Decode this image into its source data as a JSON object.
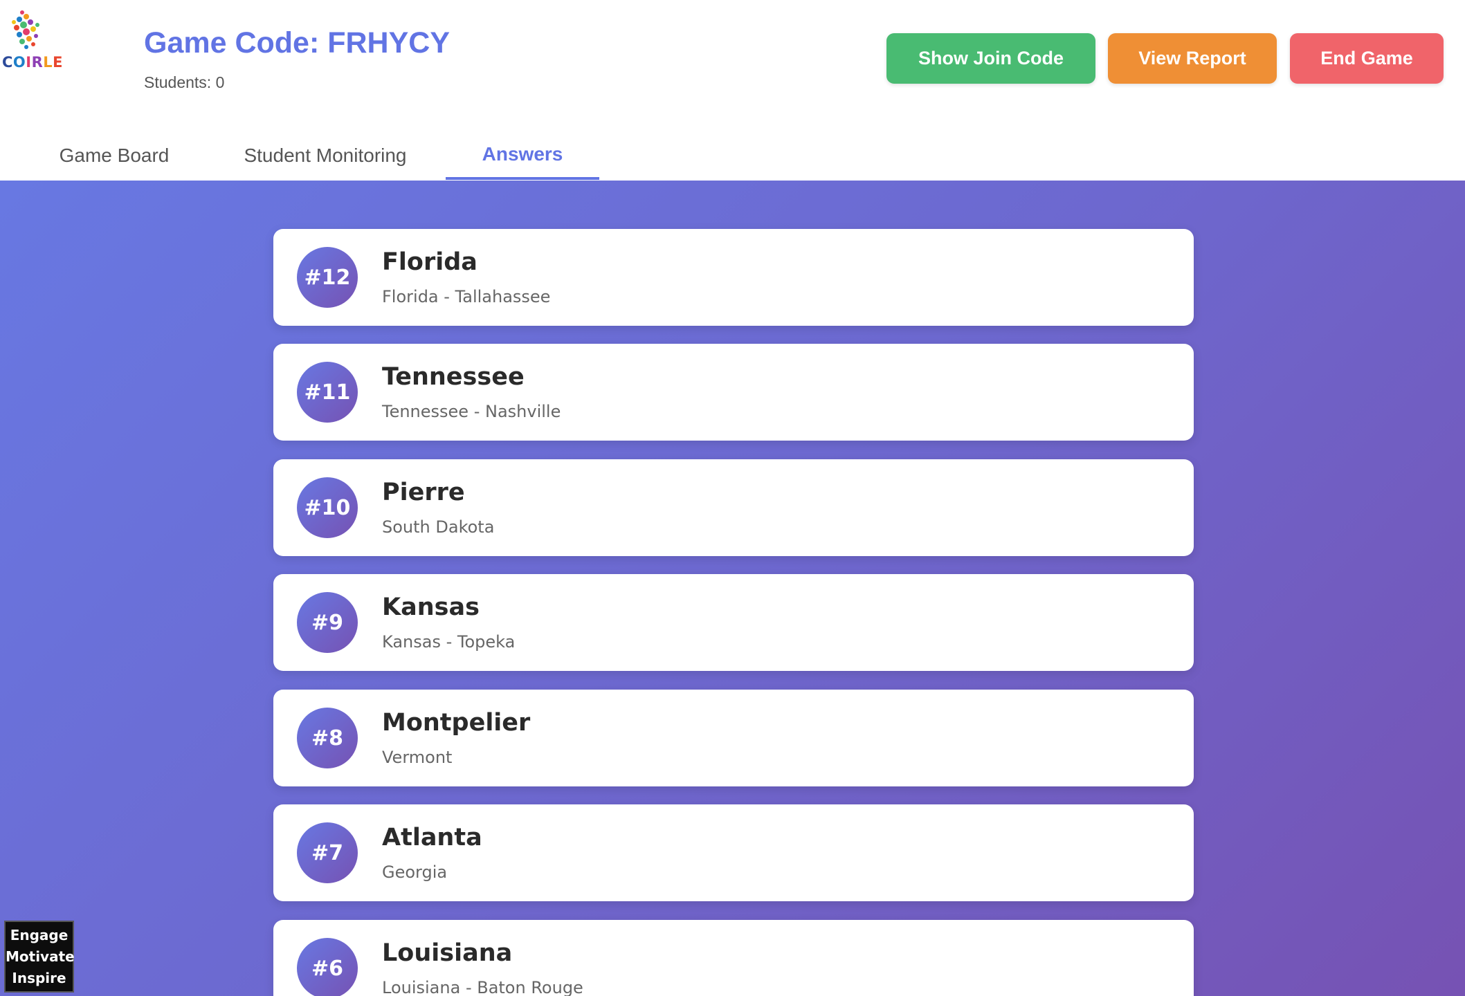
{
  "logo": {
    "letters": [
      "C",
      "O",
      "I",
      "R",
      "L",
      "E"
    ],
    "icon": "coirle-logo-icon"
  },
  "header": {
    "game_code": "Game Code: FRHYCY",
    "students": "Students: 0"
  },
  "buttons": {
    "show_join_code": "Show Join Code",
    "view_report": "View Report",
    "end_game": "End Game"
  },
  "tabs": [
    {
      "label": "Game Board",
      "active": false
    },
    {
      "label": "Student Monitoring",
      "active": false
    },
    {
      "label": "Answers",
      "active": true
    }
  ],
  "answers": [
    {
      "number": "#12",
      "title": "Florida",
      "subtitle": "Florida - Tallahassee"
    },
    {
      "number": "#11",
      "title": "Tennessee",
      "subtitle": "Tennessee - Nashville"
    },
    {
      "number": "#10",
      "title": "Pierre",
      "subtitle": "South Dakota"
    },
    {
      "number": "#9",
      "title": "Kansas",
      "subtitle": "Kansas - Topeka"
    },
    {
      "number": "#8",
      "title": "Montpelier",
      "subtitle": "Vermont"
    },
    {
      "number": "#7",
      "title": "Atlanta",
      "subtitle": "Georgia"
    },
    {
      "number": "#6",
      "title": "Louisiana",
      "subtitle": "Louisiana - Baton Rouge"
    }
  ],
  "badge": {
    "lines": [
      "Engage",
      "Motivate",
      "Inspire"
    ]
  },
  "colors": {
    "accent": "#6174e4",
    "join": "#49bb72",
    "report": "#ef8f35",
    "end": "#f0646a"
  }
}
